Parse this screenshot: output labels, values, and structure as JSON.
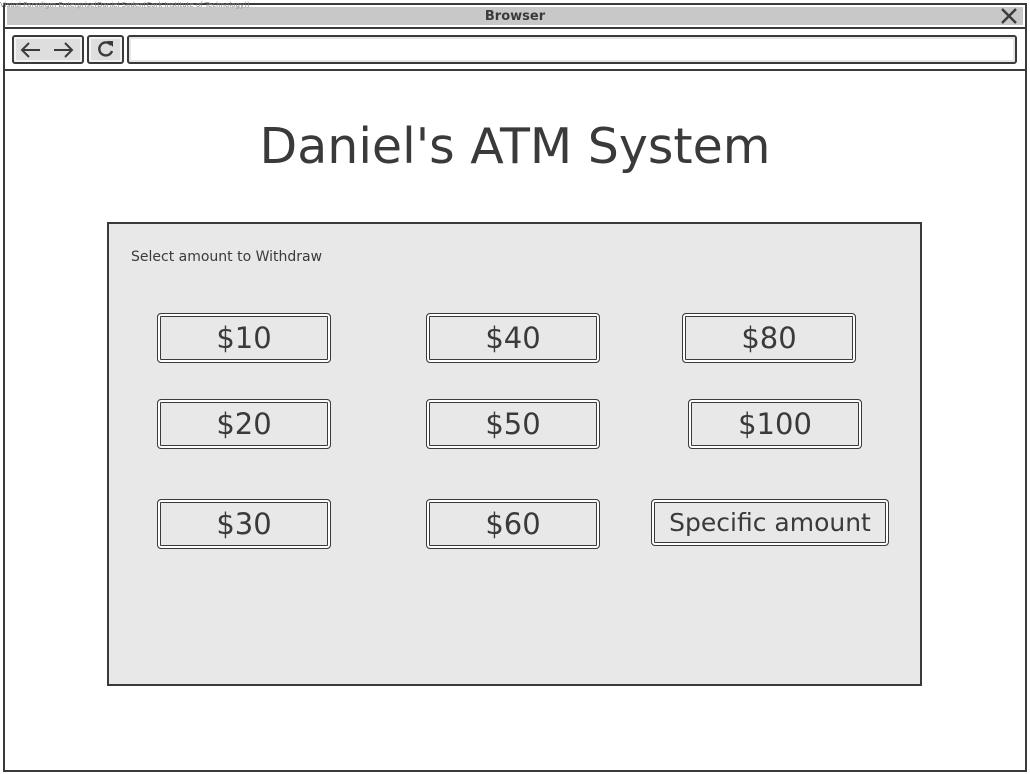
{
  "watermark": "Visual Paradigm Enterprise(Daniel Soden(Cork Institute of Technology))",
  "window": {
    "title": "Browser",
    "close_icon": "close-x-icon"
  },
  "toolbar": {
    "back_icon": "arrow-left-icon",
    "forward_icon": "arrow-right-icon",
    "reload_icon": "reload-icon",
    "address_value": ""
  },
  "page": {
    "title": "Daniel's ATM System",
    "prompt": "Select amount to Withdraw",
    "buttons": {
      "b10": "$10",
      "b40": "$40",
      "b80": "$80",
      "b20": "$20",
      "b50": "$50",
      "b100": "$100",
      "b30": "$30",
      "b60": "$60",
      "specific": "Specific amount"
    }
  },
  "colors": {
    "stroke": "#3a3a3a",
    "titlebar": "#c8c8c8",
    "panel": "#e8e8e8",
    "page_bg": "#ffffff"
  }
}
